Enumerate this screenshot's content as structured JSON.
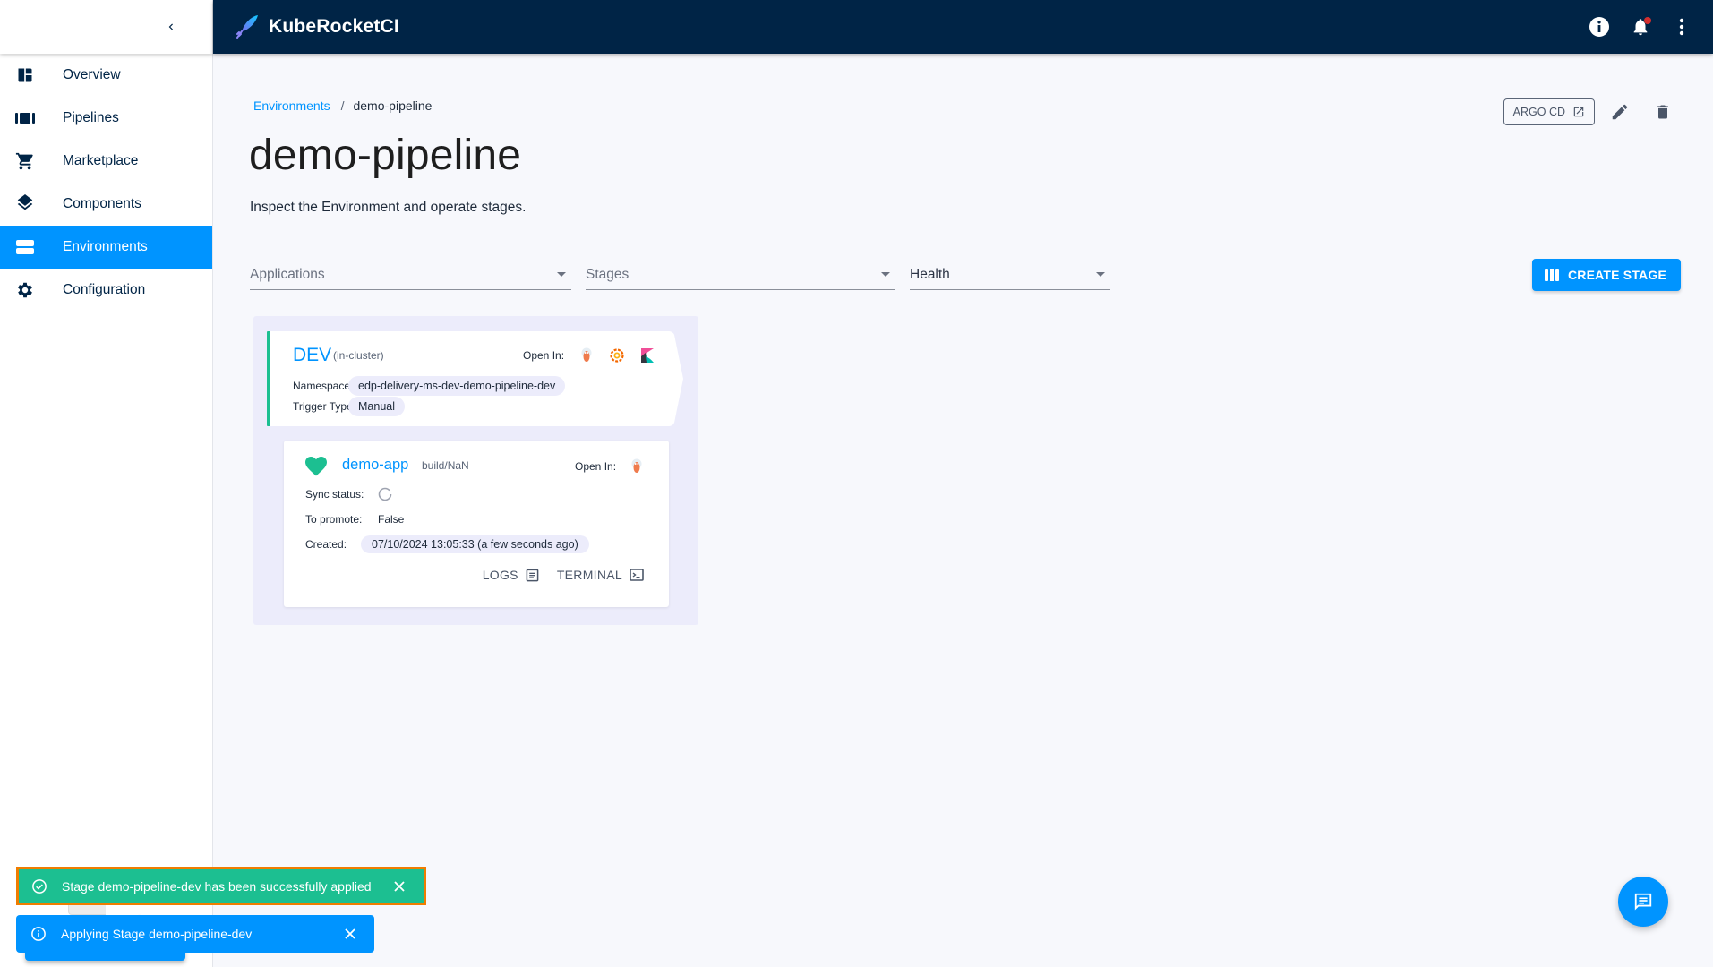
{
  "app": {
    "brand_name": "KubeRocketCI",
    "logo_icon": "rocket-feather-icon"
  },
  "topbar": {
    "icons": [
      "info-icon",
      "notifications-bell-icon",
      "more-vert-icon"
    ],
    "has_unread_notifications": true
  },
  "sidebar": {
    "collapse_icon": "chevron-left-icon",
    "items": [
      {
        "label": "Overview",
        "icon": "dashboard-icon",
        "active": false
      },
      {
        "label": "Pipelines",
        "icon": "pipelines-icon",
        "active": false
      },
      {
        "label": "Marketplace",
        "icon": "cart-icon",
        "active": false
      },
      {
        "label": "Components",
        "icon": "layers-icon",
        "active": false
      },
      {
        "label": "Environments",
        "icon": "environments-icon",
        "active": true
      },
      {
        "label": "Configuration",
        "icon": "gear-icon",
        "active": false
      }
    ]
  },
  "breadcrumb": {
    "parent": "Environments",
    "separator": "/",
    "current": "demo-pipeline"
  },
  "page": {
    "title": "demo-pipeline",
    "description": "Inspect the Environment and operate stages."
  },
  "header_actions": {
    "argo_label": "ARGO CD",
    "edit_icon": "pencil-icon",
    "delete_icon": "trash-icon"
  },
  "filters": {
    "applications": {
      "placeholder": "Applications",
      "value": ""
    },
    "stages": {
      "placeholder": "Stages",
      "value": ""
    },
    "health": {
      "placeholder": "Health",
      "value": ""
    }
  },
  "create_stage": {
    "label": "CREATE STAGE"
  },
  "stage": {
    "name": "DEV",
    "cluster": "(in-cluster)",
    "open_in_label": "Open In:",
    "open_in_tools": [
      "argocd-icon",
      "grafana-icon",
      "kibana-icon"
    ],
    "namespace_label": "Namespace:",
    "namespace": "edp-delivery-ms-dev-demo-pipeline-dev",
    "trigger_label": "Trigger Type:",
    "trigger": "Manual",
    "accent_color": "#1cbf91"
  },
  "application": {
    "health_icon": "heart-icon",
    "health_color": "#1cbf91",
    "name": "demo-app",
    "version": "build/NaN",
    "open_in_label": "Open In:",
    "open_in_tools": [
      "argocd-icon"
    ],
    "sync_label": "Sync status:",
    "sync_icon": "sync-pending-icon",
    "promote_label": "To promote:",
    "promote_value": "False",
    "created_label": "Created:",
    "created_value": "07/10/2024 13:05:33 (a few seconds ago)",
    "logs_label": "LOGS",
    "terminal_label": "TERMINAL"
  },
  "notifications": [
    {
      "type": "success",
      "message": "Stage demo-pipeline-dev has been successfully applied",
      "color": "#1cbf91"
    },
    {
      "type": "info",
      "message": "Applying Stage demo-pipeline-dev",
      "color": "#0094ff"
    }
  ],
  "fab": {
    "icon": "chat-icon"
  },
  "colors": {
    "primary": "#0094ff",
    "topbar": "#002446",
    "success": "#1cbf91",
    "highlight_border": "#ef7d00"
  }
}
